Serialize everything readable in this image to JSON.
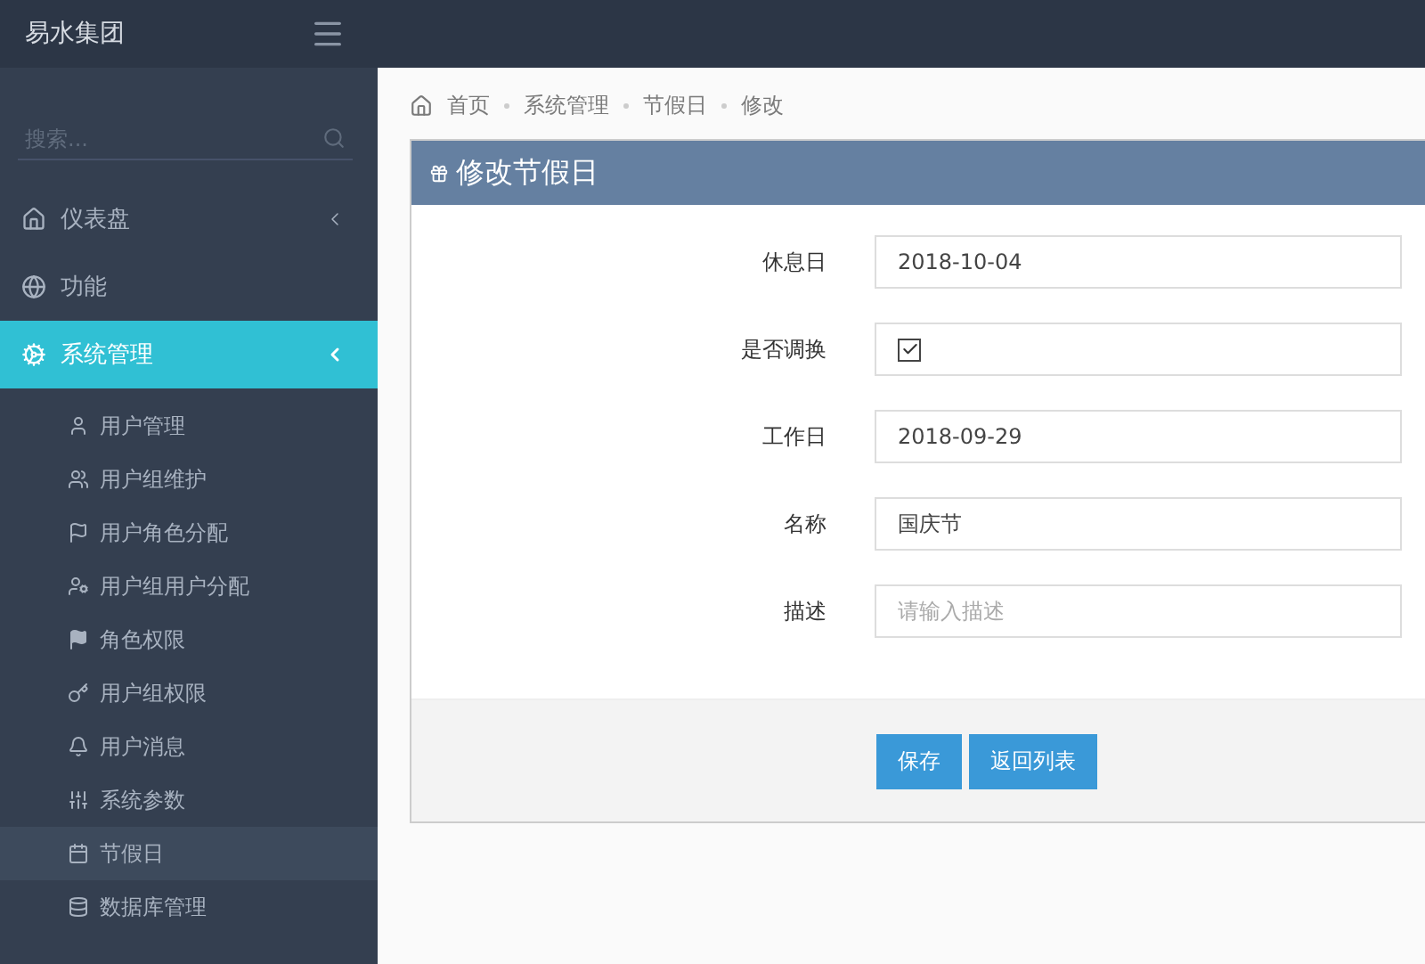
{
  "topbar": {
    "brand": "易水集团"
  },
  "sidebar": {
    "search": {
      "placeholder": "搜索..."
    },
    "menu": [
      {
        "kind": "group",
        "label": "仪表盘",
        "selected": false,
        "expanded": false
      },
      {
        "kind": "link",
        "label": "功能",
        "selected": false
      },
      {
        "kind": "group",
        "label": "系统管理",
        "selected": true,
        "expanded": true,
        "children": [
          {
            "label": "用户管理",
            "selected": false
          },
          {
            "label": "用户组维护",
            "selected": false
          },
          {
            "label": "用户角色分配",
            "selected": false
          },
          {
            "label": "用户组用户分配",
            "selected": false
          },
          {
            "label": "角色权限",
            "selected": false
          },
          {
            "label": "用户组权限",
            "selected": false
          },
          {
            "label": "用户消息",
            "selected": false
          },
          {
            "label": "系统参数",
            "selected": false
          },
          {
            "label": "节假日",
            "selected": true
          },
          {
            "label": "数据库管理",
            "selected": false
          }
        ]
      }
    ]
  },
  "breadcrumb": [
    "首页",
    "系统管理",
    "节假日",
    "修改"
  ],
  "panel": {
    "title": "修改节假日",
    "fields": [
      {
        "kind": "text",
        "label": "休息日",
        "value": "2018-10-04"
      },
      {
        "kind": "checkbox",
        "label": "是否调换",
        "checked": true
      },
      {
        "kind": "text",
        "label": "工作日",
        "value": "2018-09-29"
      },
      {
        "kind": "text",
        "label": "名称",
        "value": "国庆节"
      },
      {
        "kind": "text",
        "label": "描述",
        "placeholder": "请输入描述"
      }
    ],
    "buttons": [
      "保存",
      "返回列表"
    ]
  }
}
